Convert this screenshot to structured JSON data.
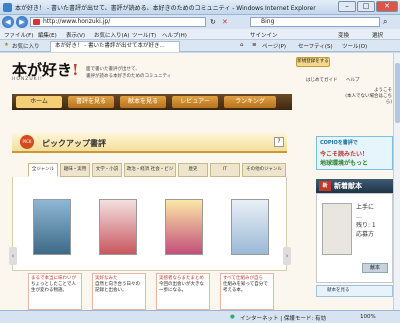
{
  "window": {
    "title": "本が好き！ - 書いた書評が出せて、書評が読める、本好きのためのコミュニティ - Windows Internet Explorer",
    "min": "–",
    "max": "□",
    "close": "✕"
  },
  "address": {
    "url": "http://www.honzuki.jp/",
    "search_engine": "Bing"
  },
  "menu": {
    "items": [
      "ファイル(F)",
      "編集(E)",
      "表示(V)",
      "お気に入り(A)",
      "ツール(T)",
      "ヘルプ(H)"
    ],
    "convert": "変換",
    "select": "選択",
    "signin": "サインイン"
  },
  "toolbar": {
    "favorites": "お気に入り",
    "tab_title": "本が好き！ - 書いた書評が出せて本が好き...",
    "page": "ページ(P)",
    "safety": "セーフティ(S)",
    "tools": "ツール(O)"
  },
  "site": {
    "logo_main": "本が好き",
    "logo_mark": "!",
    "logo_sub": "HONZUKI!",
    "tagline_1": "面で書いた書評が出せて、",
    "tagline_2": "書評が読める本好きのためのコミュニティ",
    "register": "新規登録をする",
    "links": [
      "はじめてガイド",
      "ヘルプ"
    ],
    "welcome_1": "ようこそ",
    "welcome_2": "(本人でない場合はこちら)"
  },
  "nav": {
    "items": [
      "ホーム",
      "書評を見る",
      "献本を見る",
      "レビュアー",
      "ランキング"
    ]
  },
  "pickup": {
    "badge": "PICK UP",
    "title": "ピックアップ書評",
    "help": "?",
    "genres": [
      "全ジャンル",
      "趣味・実用",
      "文学・小説",
      "政治・経済 社会・ビジネス",
      "歴史",
      "IT",
      "その他のジャンル"
    ]
  },
  "books": [
    {
      "blurb_head": "まるで本当に味わいが",
      "blurb_body": "ちょっとしたことで人生が変わる物語。"
    },
    {
      "blurb_head": "実好なみた",
      "blurb_body": "自然と向き合う日々の記録と出会い。"
    },
    {
      "blurb_head": "実感者ならまたまとめ",
      "blurb_body": "今回の出会いが大きな一歩になる。"
    },
    {
      "blurb_head": "すべて仕組みが自ら",
      "blurb_body": "仕組みを知って自分で考える本。"
    }
  ],
  "side": {
    "banner_title": "COPIOを書評で",
    "banner_line1": "今こそ読みたい！",
    "banner_line2": "地球環境がもっと",
    "new_badge": "新",
    "new_title": "新着献本",
    "new_lines": [
      "上手に",
      "…",
      "残り: 1",
      "応募方"
    ],
    "more": "献本",
    "bottom_link": "献本を見る"
  },
  "status": {
    "zone": "インターネット | 保護モード: 有効",
    "zoom": "100%"
  }
}
